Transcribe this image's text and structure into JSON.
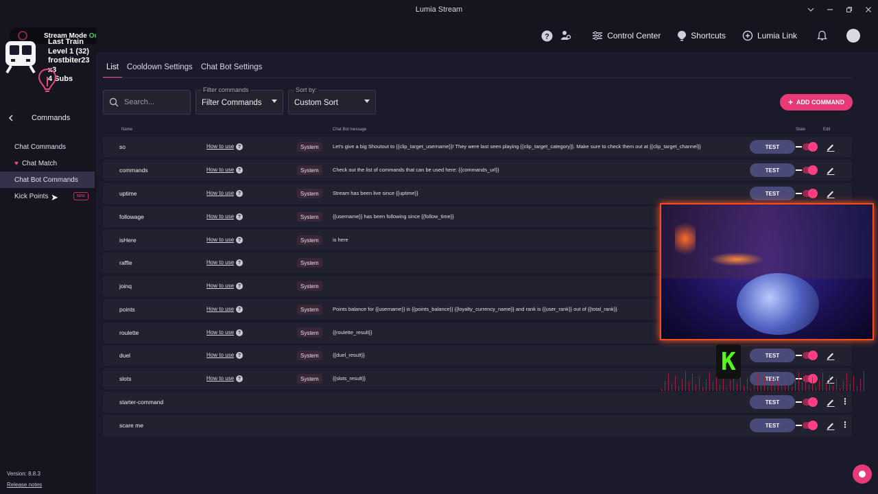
{
  "window": {
    "title": "Lumia Stream"
  },
  "header": {
    "items": [
      {
        "label": "Control Center"
      },
      {
        "label": "Shortcuts"
      },
      {
        "label": "Lumia Link"
      }
    ]
  },
  "overlay": {
    "stream_mode_label": "Stream Mode",
    "stream_mode_state": "On",
    "line1": "Last Train",
    "line2": "Level 1  (32)",
    "line3": "frostbiter23 x3",
    "line4": "4 Subs"
  },
  "sidebar": {
    "back_label": "Commands",
    "items": [
      {
        "label": "Chat Commands"
      },
      {
        "label": "Chat Match"
      },
      {
        "label": "Chat Bot Commands"
      },
      {
        "label": "Kick Points"
      }
    ],
    "new_badge": "NEW",
    "version": "Version: 8.8.3",
    "release_notes": "Release notes"
  },
  "tabs": [
    {
      "label": "List"
    },
    {
      "label": "Cooldown Settings"
    },
    {
      "label": "Chat Bot Settings"
    }
  ],
  "filters": {
    "search_placeholder": "Search...",
    "filter_label": "Filter commands",
    "filter_value": "Filter Commands",
    "sort_label": "Sort by:",
    "sort_value": "Custom Sort"
  },
  "add_command_label": "ADD COMMAND",
  "table": {
    "headers": {
      "name": "Name",
      "message": "Chat Bot message",
      "state": "State",
      "edit": "Edit"
    },
    "how_to_use": "How to use",
    "system": "System",
    "test": "TEST",
    "rows": [
      {
        "name": "so",
        "message": "Let's give a big Shoutout to {{clip_target_username}}! They were last seen playing {{clip_target_category}}. Make sure to check them out at {{clip_target_channel}}"
      },
      {
        "name": "commands",
        "message": "Check out the list of commands that can be used here: {{commands_url}}"
      },
      {
        "name": "uptime",
        "message": "Stream has been live since {{uptime}}"
      },
      {
        "name": "followage",
        "message": "{{username}} has been following since {{follow_time}}"
      },
      {
        "name": "isHere",
        "message": "is here"
      },
      {
        "name": "raffle",
        "message": ""
      },
      {
        "name": "joinq",
        "message": ""
      },
      {
        "name": "points",
        "message": "Points balance for {{username}} is {{points_balance}} {{loyalty_currency_name}} and rank is {{user_rank}} out of {{total_rank}}"
      },
      {
        "name": "roulette",
        "message": "{{roulette_result}}"
      },
      {
        "name": "duel",
        "message": "{{duel_result}}"
      },
      {
        "name": "slots",
        "message": "{{slots_result}}"
      },
      {
        "name": "starter-command",
        "message": ""
      },
      {
        "name": "scare me",
        "message": ""
      }
    ]
  },
  "kick_logo_letter": "K"
}
